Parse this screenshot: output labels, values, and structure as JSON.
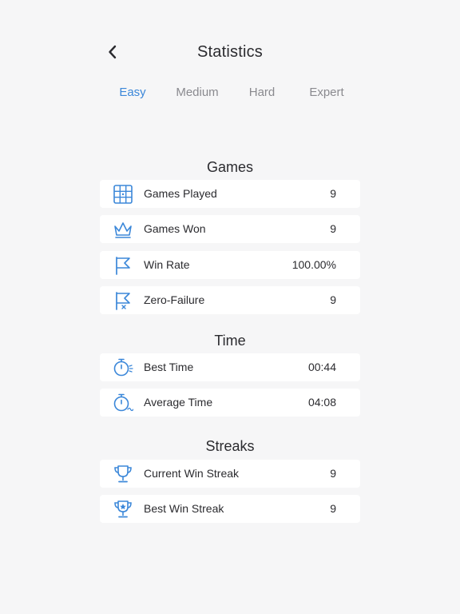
{
  "header": {
    "title": "Statistics",
    "back_icon": "chevron-left-icon"
  },
  "tabs": [
    {
      "label": "Easy",
      "active": true
    },
    {
      "label": "Medium",
      "active": false
    },
    {
      "label": "Hard",
      "active": false
    },
    {
      "label": "Expert",
      "active": false
    }
  ],
  "colors": {
    "accent": "#3b87d9",
    "background": "#f6f6f7",
    "card": "#ffffff",
    "text": "#2b2b2f",
    "inactive_tab": "#8a8a8f"
  },
  "sections": [
    {
      "title": "Games",
      "rows": [
        {
          "icon": "sudoku-grid-icon",
          "label": "Games Played",
          "value": "9"
        },
        {
          "icon": "crown-icon",
          "label": "Games Won",
          "value": "9"
        },
        {
          "icon": "flag-icon",
          "label": "Win Rate",
          "value": "100.00%"
        },
        {
          "icon": "flag-x-icon",
          "label": "Zero-Failure",
          "value": "9"
        }
      ]
    },
    {
      "title": "Time",
      "rows": [
        {
          "icon": "stopwatch-fast-icon",
          "label": "Best Time",
          "value": "00:44"
        },
        {
          "icon": "stopwatch-wave-icon",
          "label": "Average Time",
          "value": "04:08"
        }
      ]
    },
    {
      "title": "Streaks",
      "rows": [
        {
          "icon": "trophy-icon",
          "label": "Current Win Streak",
          "value": "9"
        },
        {
          "icon": "trophy-star-icon",
          "label": "Best Win Streak",
          "value": "9"
        }
      ]
    }
  ]
}
